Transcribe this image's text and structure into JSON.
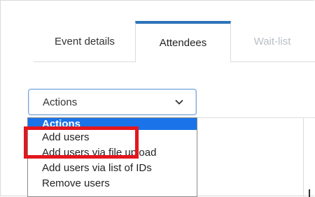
{
  "tabs": [
    {
      "label": "Event details",
      "active": false
    },
    {
      "label": "Attendees",
      "active": true
    },
    {
      "label": "Wait-list",
      "active": false,
      "disabled": true
    }
  ],
  "actions_select": {
    "selected": "Actions",
    "chevron_icon": "chevron-down-icon"
  },
  "dropdown": {
    "options": [
      "Actions",
      "Add users",
      "Add users via file upload",
      "Add users via list of IDs",
      "Remove users"
    ],
    "highlighted": "Actions"
  },
  "annotation": {
    "highlight_color": "#e3161e",
    "highlighted_option": "Add users"
  },
  "colors": {
    "accent": "#2d73b8",
    "selected_option_bg": "#1a73e8"
  }
}
